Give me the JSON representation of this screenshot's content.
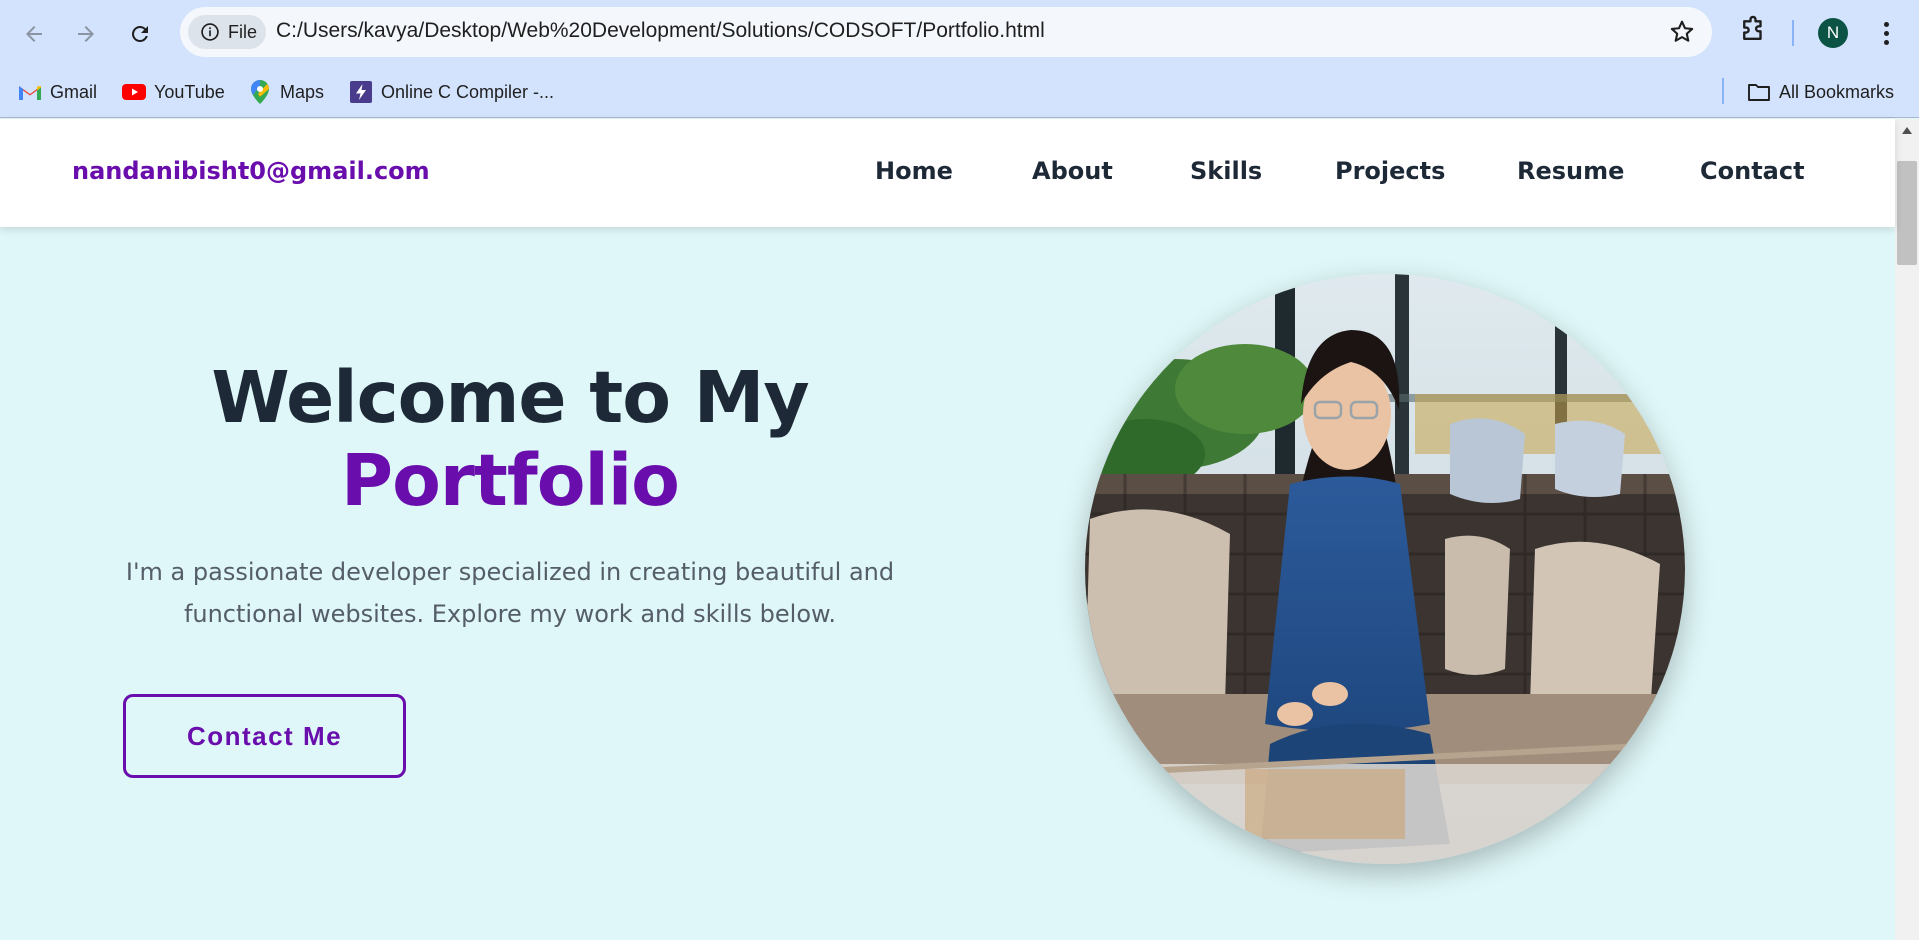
{
  "browser": {
    "url": "C:/Users/kavya/Desktop/Web%20Development/Solutions/CODSOFT/Portfolio.html",
    "url_scheme_label": "File",
    "profile_initial": "N",
    "icons": [
      "back-arrow-icon",
      "forward-arrow-icon",
      "reload-icon",
      "info-icon",
      "star-icon",
      "extensions-icon",
      "more-vert-icon"
    ]
  },
  "bookmarks": {
    "items": [
      {
        "label": "Gmail",
        "icon": "gmail-icon"
      },
      {
        "label": "YouTube",
        "icon": "youtube-icon"
      },
      {
        "label": "Maps",
        "icon": "maps-icon"
      },
      {
        "label": "Online C Compiler -...",
        "icon": "bolt-icon"
      }
    ],
    "all_bookmarks_label": "All Bookmarks"
  },
  "site": {
    "email": "nandanibisht0@gmail.com",
    "nav": [
      "Home",
      "About",
      "Skills",
      "Projects",
      "Resume",
      "Contact"
    ]
  },
  "hero": {
    "title_line1": "Welcome to My",
    "title_line2": "Portfolio",
    "description": "I'm a passionate developer specialized in creating beautiful and functional websites. Explore my work and skills below.",
    "cta_label": "Contact Me"
  },
  "colors": {
    "accent": "#6a0dad",
    "heading": "#1e2937",
    "page_background": "#dff7f8",
    "browser_frame": "#d3e3fd"
  }
}
